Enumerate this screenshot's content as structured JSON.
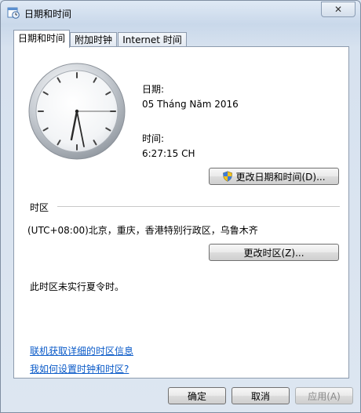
{
  "window": {
    "title": "日期和时间",
    "close_symbol": "✕"
  },
  "tabs": [
    {
      "label": "日期和时间",
      "active": true
    },
    {
      "label": "附加时钟",
      "active": false
    },
    {
      "label": "Internet 时间",
      "active": false
    }
  ],
  "datetime": {
    "date_label": "日期:",
    "date_value": "05 Tháng Năm 2016",
    "time_label": "时间:",
    "time_value": "6:27:15 CH",
    "change_button": "更改日期和时间(D)..."
  },
  "timezone": {
    "section_label": "时区",
    "value": "(UTC+08:00)北京，重庆，香港特别行政区，乌鲁木齐",
    "change_button": "更改时区(Z)...",
    "dst_note": "此时区未实行夏令时。"
  },
  "links": {
    "online_info": "联机获取详细的时区信息",
    "how_to": "我如何设置时钟和时区?"
  },
  "footer": {
    "ok": "确定",
    "cancel": "取消",
    "apply": "应用(A)"
  },
  "icons": {
    "title": "calendar-clock-icon",
    "shield": "uac-shield-icon",
    "close": "close-icon"
  }
}
